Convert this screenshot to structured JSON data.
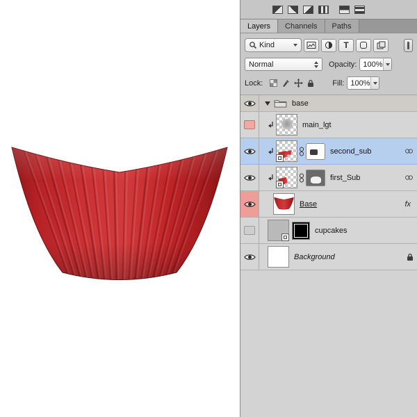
{
  "panel": {
    "tabs": [
      {
        "label": "Layers"
      },
      {
        "label": "Channels"
      },
      {
        "label": "Paths"
      }
    ],
    "filter": {
      "kind_label": "Kind",
      "type_icon": "T"
    },
    "blend_row": {
      "mode": "Normal",
      "opacity_label": "Opacity:",
      "opacity_value": "100%"
    },
    "lock_row": {
      "label": "Lock:",
      "fill_label": "Fill:",
      "fill_value": "100%"
    },
    "layers": [
      {
        "name": "base"
      },
      {
        "name": "main_lgt"
      },
      {
        "name": "second_sub"
      },
      {
        "name": "first_Sub"
      },
      {
        "name": "Base",
        "style_badge": "fx"
      },
      {
        "name": "cupcakes"
      },
      {
        "name": "Background"
      }
    ]
  },
  "colors": {
    "selection": "#b7cfee",
    "red_label": "#ef9d98",
    "wrapper_red": "#c62d30"
  }
}
